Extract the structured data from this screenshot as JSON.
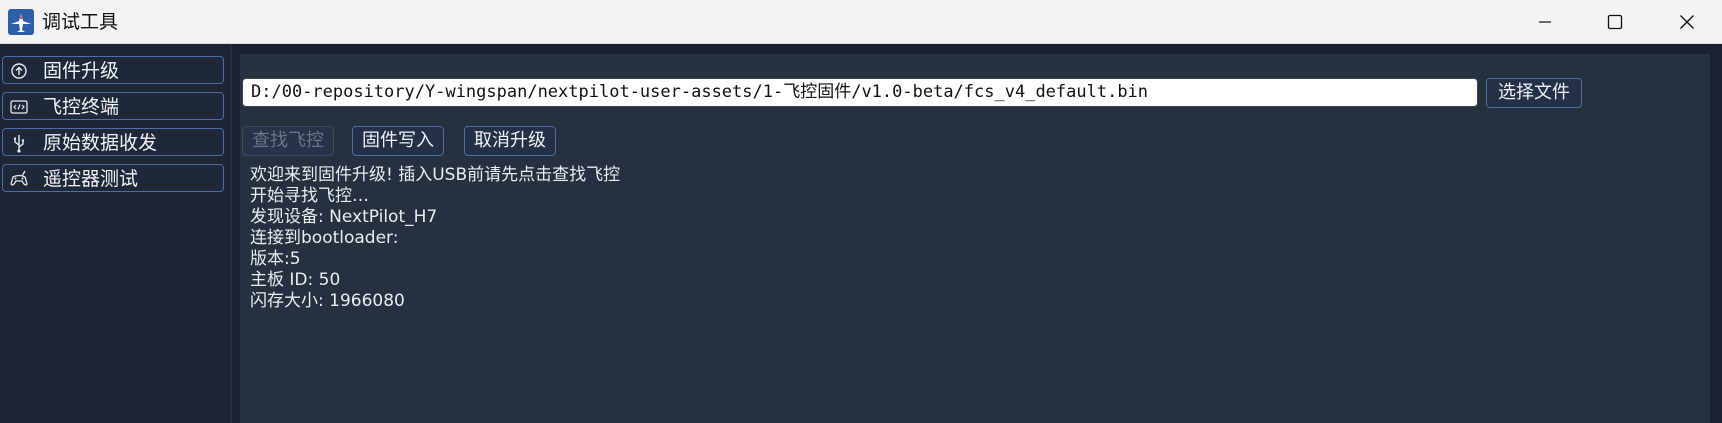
{
  "window": {
    "title": "调试工具",
    "controls": [
      "minimize-icon",
      "maximize-icon",
      "close-icon"
    ]
  },
  "sidebar": {
    "items": [
      {
        "label": "固件升级",
        "icon": "upgrade-icon"
      },
      {
        "label": "飞控终端",
        "icon": "terminal-icon"
      },
      {
        "label": "原始数据收发",
        "icon": "usb-icon"
      },
      {
        "label": "遥控器测试",
        "icon": "controller-icon"
      }
    ]
  },
  "main": {
    "file_path": "D:/00-repository/Y-wingspan/nextpilot-user-assets/1-飞控固件/v1.0-beta/fcs_v4_default.bin",
    "select_file_label": "选择文件",
    "buttons": {
      "find_label": "查找飞控",
      "write_label": "固件写入",
      "cancel_label": "取消升级"
    },
    "log": [
      "欢迎来到固件升级! 插入USB前请先点击查找飞控",
      "开始寻找飞控…",
      "发现设备: NextPilot_H7",
      "连接到bootloader:",
      "版本:5",
      "主板 ID: 50",
      "闪存大小: 1966080"
    ]
  },
  "colors": {
    "background": "#1b2130",
    "panel": "#27303f",
    "accent_border": "#4a6fa5",
    "text": "#f0f2f5",
    "disabled_text": "#6b7484"
  }
}
